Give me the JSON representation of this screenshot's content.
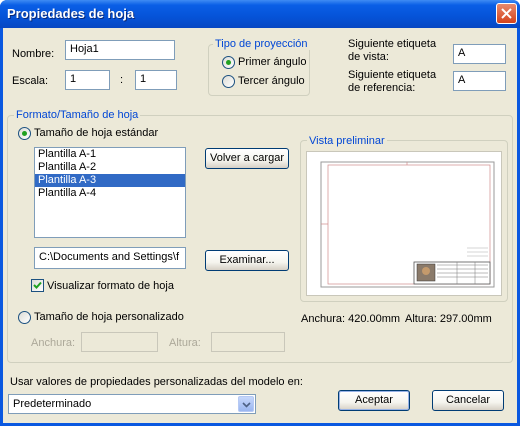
{
  "window": {
    "title": "Propiedades de hoja"
  },
  "name": {
    "label": "Nombre:",
    "value": "Hoja1"
  },
  "scale": {
    "label": "Escala:",
    "left": "1",
    "separator": ":",
    "right": "1"
  },
  "projection": {
    "legend": "Tipo de proyección",
    "options": [
      {
        "label": "Primer ángulo",
        "selected": true
      },
      {
        "label": "Tercer ángulo",
        "selected": false
      }
    ]
  },
  "next_view_label": {
    "label_line1": "Siguiente etiqueta",
    "label_line2": "de vista:",
    "value": "A"
  },
  "next_ref_label": {
    "label_line1": "Siguiente etiqueta",
    "label_line2": "de referencia:",
    "value": "A"
  },
  "format": {
    "legend": "Formato/Tamaño de hoja",
    "standard_radio": "Tamaño de hoja estándar",
    "templates": [
      "Plantilla A-1",
      "Plantilla A-2",
      "Plantilla A-3",
      "Plantilla A-4"
    ],
    "selected_index": 2,
    "reload_button": "Volver a cargar",
    "path": "C:\\Documents and Settings\\f",
    "browse_button": "Examinar...",
    "show_format_checkbox": "Visualizar formato de hoja",
    "show_format_checked": true,
    "custom_radio": "Tamaño de hoja personalizado",
    "width_label": "Anchura:",
    "height_label": "Altura:",
    "width_value": "",
    "height_value": ""
  },
  "preview": {
    "legend": "Vista preliminar",
    "width_text": "Anchura:  420.00mm",
    "height_text": "Altura:  297.00mm"
  },
  "custom_props": {
    "label": "Usar valores de propiedades personalizadas del modelo en:",
    "selected": "Predeterminado"
  },
  "actions": {
    "ok": "Aceptar",
    "cancel": "Cancelar"
  },
  "colors": {
    "title_bar": "#0553d8",
    "dialog_bg": "#ece9d8",
    "selection": "#316ac5",
    "group_legend": "#0046d5"
  }
}
